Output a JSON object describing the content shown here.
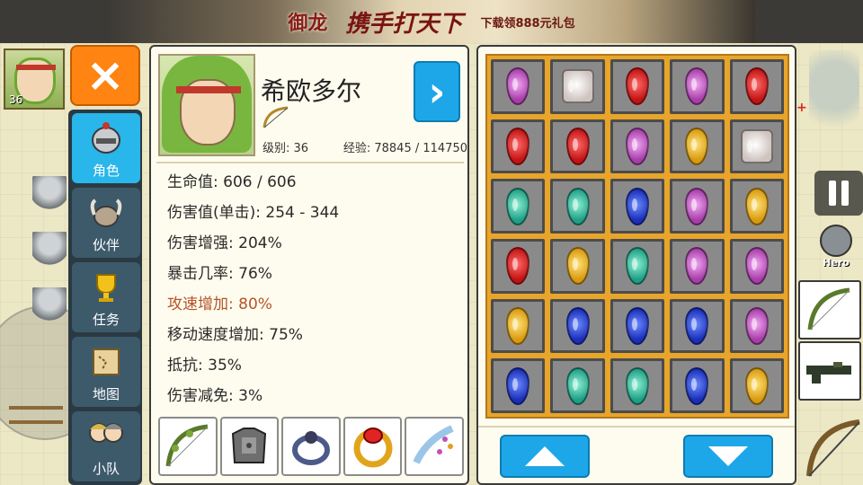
{
  "banner": {
    "logo": "御龙",
    "slogan": "携手打天下",
    "gift": "下载领888元礼包"
  },
  "top_avatar": {
    "level": "36"
  },
  "close_label": "×",
  "side_menu": [
    {
      "label": "角色",
      "icon": "helmet-icon",
      "active": true
    },
    {
      "label": "伙伴",
      "icon": "horned-helmet-icon",
      "active": false
    },
    {
      "label": "任务",
      "icon": "trophy-icon",
      "active": false
    },
    {
      "label": "地图",
      "icon": "map-scroll-icon",
      "active": false
    },
    {
      "label": "小队",
      "icon": "party-icon",
      "active": false
    }
  ],
  "character": {
    "name": "希欧多尔",
    "weapon_type_icon": "bow-icon",
    "level_text": "级别: 36",
    "exp_text": "经验: 78845 / 114750",
    "next_label": "›"
  },
  "stats": [
    {
      "text": "生命值: 606 / 606",
      "highlight": false
    },
    {
      "text": "伤害值(单击): 254 - 344",
      "highlight": false
    },
    {
      "text": "伤害增强: 204%",
      "highlight": false
    },
    {
      "text": "暴击几率: 76%",
      "highlight": false
    },
    {
      "text": "攻速增加: 80%",
      "highlight": true
    },
    {
      "text": "移动速度增加: 75%",
      "highlight": false
    },
    {
      "text": "抵抗: 35%",
      "highlight": false
    },
    {
      "text": "伤害减免: 3%",
      "highlight": false
    }
  ],
  "equipment": [
    {
      "name": "bow-icon"
    },
    {
      "name": "armor-icon"
    },
    {
      "name": "ring-icon"
    },
    {
      "name": "ruby-ring-icon"
    },
    {
      "name": "feather-charm-icon"
    }
  ],
  "inventory": {
    "rows": [
      [
        "purple",
        "white",
        "red",
        "purple",
        "red"
      ],
      [
        "red",
        "red",
        "purple",
        "yellow",
        "white"
      ],
      [
        "cyan",
        "cyan",
        "blue",
        "purple",
        "yellow"
      ],
      [
        "red",
        "yellow",
        "cyan",
        "purple",
        "purple"
      ],
      [
        "yellow",
        "blue",
        "blue",
        "blue",
        "purple"
      ],
      [
        "blue",
        "cyan",
        "cyan",
        "blue",
        "yellow"
      ]
    ]
  },
  "hero_label": "Hero",
  "colors": {
    "accent_blue": "#1ea7e8",
    "close_orange": "#ff8411",
    "stat_highlight": "#b5532a",
    "inventory_frame": "#e8a52a"
  }
}
